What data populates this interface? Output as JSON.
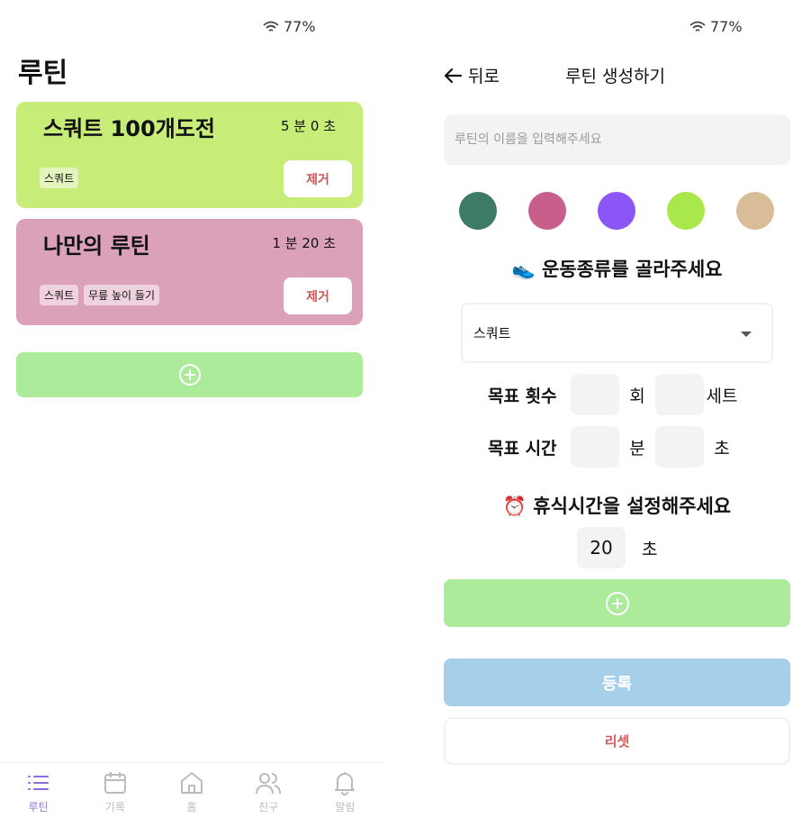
{
  "left": {
    "status": {
      "battery": "77%"
    },
    "title": "루틴",
    "routines": [
      {
        "name": "스쿼트 100개도전",
        "time": "5 분 0 초",
        "tags": [
          "스쿼트"
        ],
        "remove_label": "제거",
        "color": "#c8ec78"
      },
      {
        "name": "나만의 루틴",
        "time": "1 분 20 초",
        "tags": [
          "스쿼트",
          "무릎 높이 들기"
        ],
        "remove_label": "제거",
        "color": "#dba1b9"
      }
    ],
    "add_icon": "plus-circle-icon",
    "tabs": [
      {
        "label": "루틴",
        "icon": "list-icon",
        "active": true
      },
      {
        "label": "기록",
        "icon": "calendar-icon",
        "active": false
      },
      {
        "label": "홈",
        "icon": "home-icon",
        "active": false
      },
      {
        "label": "친구",
        "icon": "friends-icon",
        "active": false
      },
      {
        "label": "알림",
        "icon": "bell-icon",
        "active": false
      }
    ]
  },
  "right": {
    "status": {
      "battery": "77%"
    },
    "back_label": "뒤로",
    "header_title": "루틴 생성하기",
    "name_placeholder": "루틴의 이름을 입력해주세요",
    "colors": [
      "#3d7a67",
      "#c85f8a",
      "#8c55f5",
      "#a9e84a",
      "#d9bc98"
    ],
    "exercise_title": "👟 운동종류를 골라주세요",
    "exercise_selected": "스쿼트",
    "goal_count_label": "목표 횟수",
    "count_unit": "회",
    "set_unit": "세트",
    "goal_time_label": "목표 시간",
    "minute_unit": "분",
    "second_unit": "초",
    "rest_title": "⏰ 휴식시간을 설정해주세요",
    "rest_value": "20",
    "rest_unit": "초",
    "register_label": "등록",
    "reset_label": "리셋"
  }
}
